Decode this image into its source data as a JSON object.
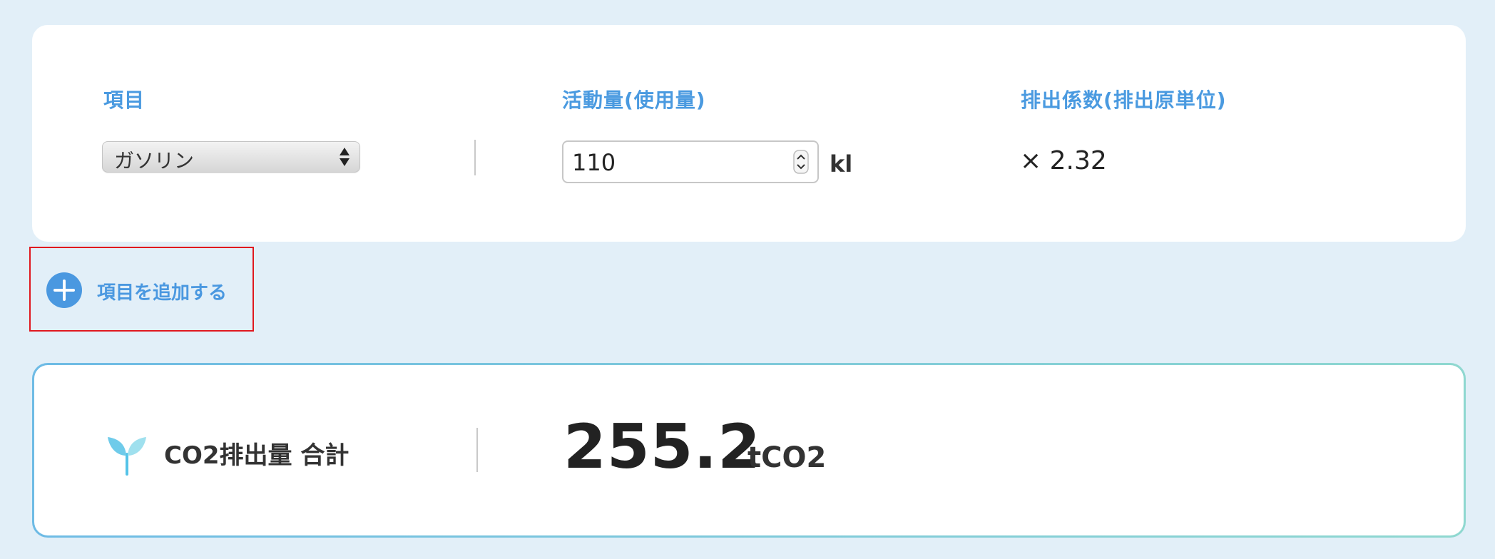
{
  "header": {
    "col_item": "項目",
    "col_activity": "活動量(使用量)",
    "col_factor": "排出係数(排出原単位)"
  },
  "row": {
    "item_selected": "ガソリン",
    "activity_value": "110",
    "activity_unit": "kl",
    "factor": "× 2.32"
  },
  "add_item": {
    "label": "項目を追加する",
    "icon": "plus-circle-icon"
  },
  "total": {
    "label": "CO2排出量 合計",
    "value": "255.2",
    "unit": "tCO2",
    "icon": "sprout-icon"
  },
  "colors": {
    "accent": "#4a98e0",
    "background": "#e2eff8",
    "highlight_border": "#e0181f"
  }
}
